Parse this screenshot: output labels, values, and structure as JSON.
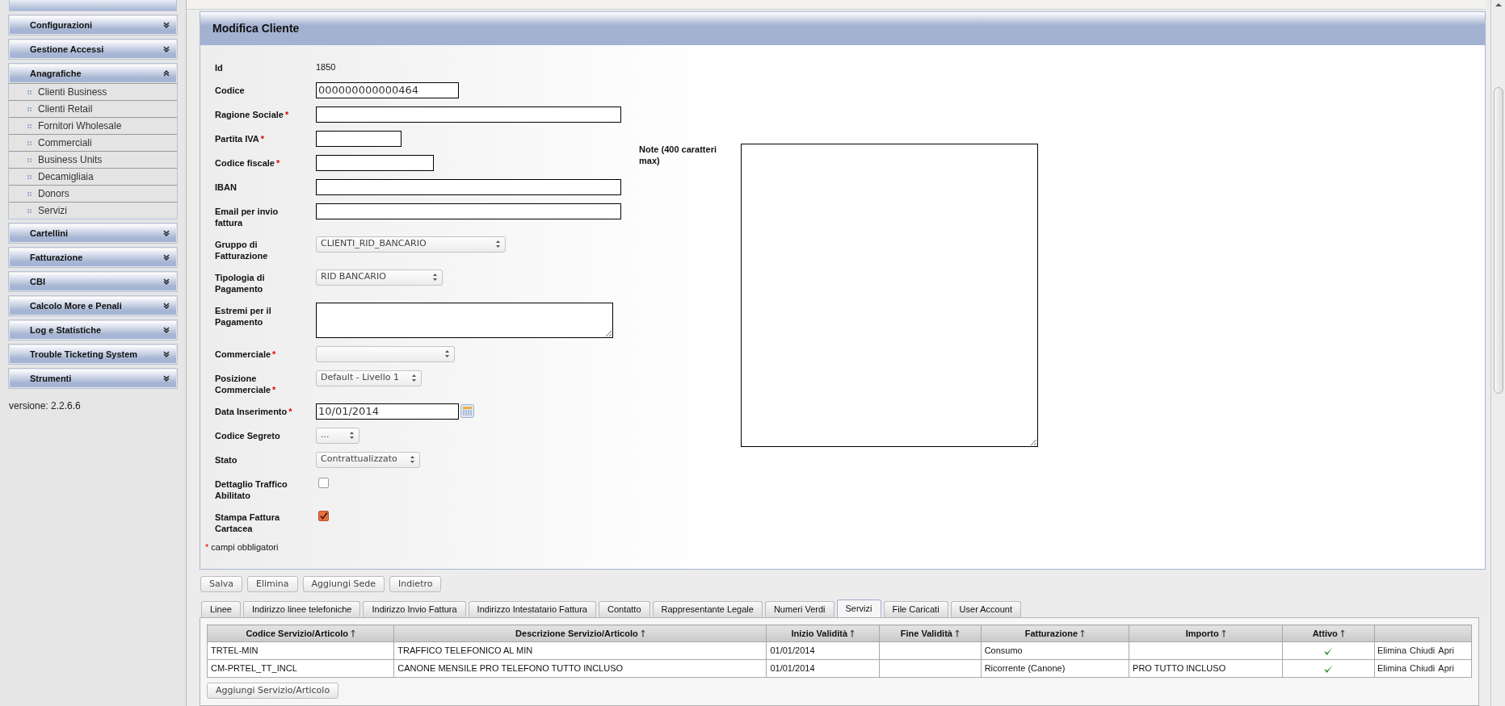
{
  "sidebar": {
    "sections": [
      {
        "label": "Configurazioni",
        "expanded": false
      },
      {
        "label": "Gestione Accessi",
        "expanded": false
      },
      {
        "label": "Anagrafiche",
        "expanded": true,
        "items": [
          "Clienti Business",
          "Clienti Retail",
          "Fornitori Wholesale",
          "Commerciali",
          "Business Units",
          "Decamigliaia",
          "Donors",
          "Servizi"
        ]
      },
      {
        "label": "Cartellini",
        "expanded": false
      },
      {
        "label": "Fatturazione",
        "expanded": false
      },
      {
        "label": "CBI",
        "expanded": false
      },
      {
        "label": "Calcolo More e Penali",
        "expanded": false
      },
      {
        "label": "Log e Statistiche",
        "expanded": false
      },
      {
        "label": "Trouble Ticketing System",
        "expanded": false
      },
      {
        "label": "Strumenti",
        "expanded": false
      }
    ],
    "version": "versione: 2.2.6.6"
  },
  "form": {
    "title": "Modifica Cliente",
    "required_mark": "*",
    "fields": [
      {
        "kind": "static",
        "label": "Id",
        "required": false,
        "value": "1850"
      },
      {
        "kind": "text",
        "label": "Codice",
        "required": false,
        "value": "000000000000464"
      },
      {
        "kind": "text",
        "label": "Ragione Sociale",
        "required": true
      },
      {
        "kind": "text",
        "label": "Partita IVA",
        "required": true
      },
      {
        "kind": "text",
        "label": "Codice fiscale",
        "required": true
      },
      {
        "kind": "text",
        "label": "IBAN",
        "required": false
      },
      {
        "kind": "text",
        "label": "Email per invio fattura",
        "required": false
      },
      {
        "kind": "select",
        "label": "Gruppo di Fatturazione",
        "required": false,
        "value": "CLIENTI_RID_BANCARIO"
      },
      {
        "kind": "select",
        "label": "Tipologia di Pagamento",
        "required": false,
        "value": "RID BANCARIO"
      },
      {
        "kind": "textarea",
        "label": "Estremi per il Pagamento",
        "required": false
      },
      {
        "kind": "select",
        "label": "Commerciale",
        "required": true
      },
      {
        "kind": "select",
        "label": "Posizione Commerciale",
        "required": true,
        "value": "Default - Livello 1"
      },
      {
        "kind": "date",
        "label": "Data Inserimento",
        "required": true,
        "value": "10/01/2014"
      },
      {
        "kind": "select",
        "label": "Codice Segreto",
        "required": false,
        "value": "..."
      },
      {
        "kind": "select",
        "label": "Stato",
        "required": false,
        "value": "Contrattualizzato"
      },
      {
        "kind": "checkbox",
        "label": "Dettaglio Traffico Abilitato",
        "required": false,
        "checked": false
      },
      {
        "kind": "checkbox",
        "label": "Stampa Fattura Cartacea",
        "required": false,
        "checked": true
      }
    ],
    "note": {
      "label": "Note (400 caratteri max)"
    },
    "required_hint": "campi obbligatori"
  },
  "buttons": [
    "Salva",
    "Elimina",
    "Aggiungi Sede",
    "Indietro"
  ],
  "tabs": [
    {
      "label": "Linee",
      "selected": false
    },
    {
      "label": "Indirizzo linee telefoniche",
      "selected": false
    },
    {
      "label": "Indirizzo Invio Fattura",
      "selected": false
    },
    {
      "label": "Indirizzo Intestatario Fattura",
      "selected": false
    },
    {
      "label": "Contatto",
      "selected": false
    },
    {
      "label": "Rappresentante Legale",
      "selected": false
    },
    {
      "label": "Numeri Verdi",
      "selected": false
    },
    {
      "label": "Servizi",
      "selected": true
    },
    {
      "label": "File Caricati",
      "selected": false
    },
    {
      "label": "User Account",
      "selected": false
    }
  ],
  "table": {
    "columns": [
      {
        "label": "Codice Servizio/Articolo",
        "sortable": true
      },
      {
        "label": "Descrizione Servizio/Articolo",
        "sortable": true
      },
      {
        "label": "Inizio Validità",
        "sortable": true
      },
      {
        "label": "Fine Validità",
        "sortable": true
      },
      {
        "label": "Fatturazione",
        "sortable": true
      },
      {
        "label": "Importo",
        "sortable": true
      },
      {
        "label": "Attivo",
        "sortable": true
      },
      {
        "sortable": false
      }
    ],
    "rows": [
      {
        "code": "TRTEL-MIN",
        "description": "TRAFFICO TELEFONICO AL MIN",
        "valid_from": "01/01/2014",
        "billing": "Consumo",
        "active": true,
        "actions": [
          "Elimina",
          "Chiudi",
          "Apri"
        ]
      },
      {
        "code": "CM-PRTEL_TT_INCL",
        "description": "CANONE MENSILE PRO TELEFONO TUTTO INCLUSO",
        "valid_from": "01/01/2014",
        "billing": "Ricorrente (Canone)",
        "amount": "PRO TUTTO INCLUSO",
        "active": true,
        "actions": [
          "Elimina",
          "Chiudi",
          "Apri"
        ]
      }
    ],
    "add_button": "Aggiungi Servizio/Articolo"
  }
}
